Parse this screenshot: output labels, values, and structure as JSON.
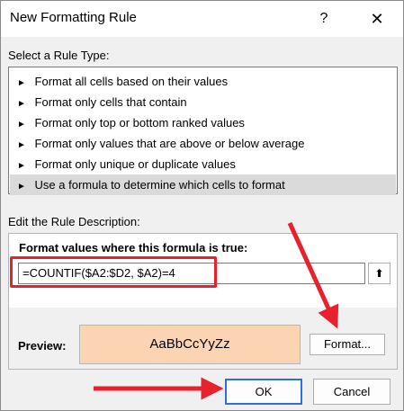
{
  "title": "New Formatting Rule",
  "titlebar": {
    "help_glyph": "?",
    "close_glyph": "✕"
  },
  "rule_type": {
    "label": "Select a Rule Type:",
    "items": [
      {
        "label": "Format all cells based on their values",
        "selected": false
      },
      {
        "label": "Format only cells that contain",
        "selected": false
      },
      {
        "label": "Format only top or bottom ranked values",
        "selected": false
      },
      {
        "label": "Format only values that are above or below average",
        "selected": false
      },
      {
        "label": "Format only unique or duplicate values",
        "selected": false
      },
      {
        "label": "Use a formula to determine which cells to format",
        "selected": true
      }
    ],
    "bullet": "►"
  },
  "description": {
    "label": "Edit the Rule Description:",
    "formula_heading": "Format values where this formula is true:",
    "formula_value": "=COUNTIF($A2:$D2, $A2)=4",
    "collapse_glyph": "⬆",
    "preview_label": "Preview:",
    "preview_text": "AaBbCcYyZz",
    "preview_fill": "#fbd4b4",
    "format_button": "Format..."
  },
  "buttons": {
    "ok": "OK",
    "cancel": "Cancel"
  },
  "annotation_color": "#e8212e"
}
